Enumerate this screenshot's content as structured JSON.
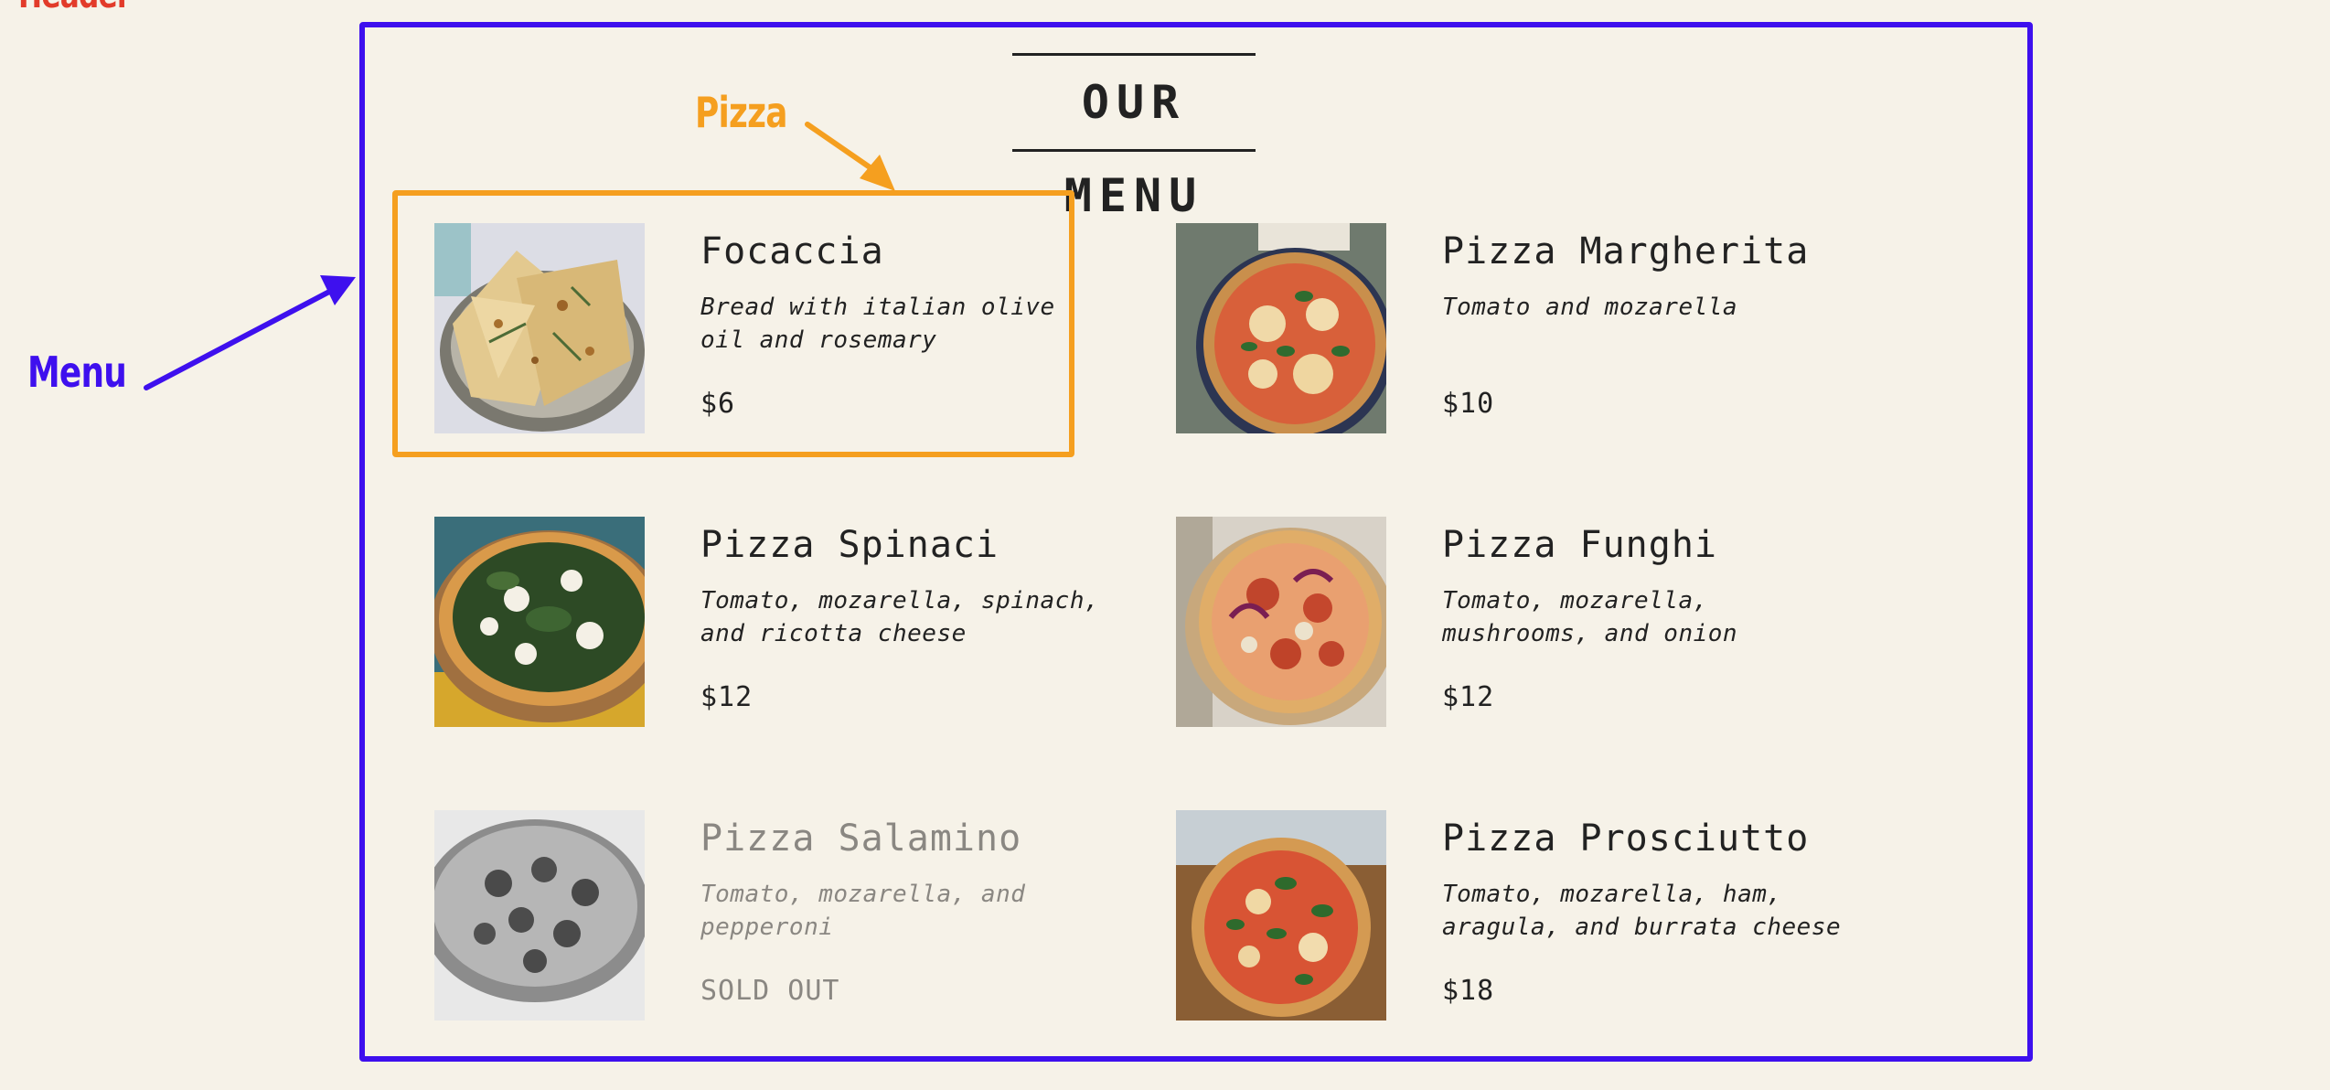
{
  "annotations": {
    "header": "Header",
    "menu": "Menu",
    "pizza": "Pizza"
  },
  "menu": {
    "title": "OUR MENU",
    "items": [
      {
        "name": "Focaccia",
        "description": "Bread with italian olive oil and rosemary",
        "price": "$6",
        "photo": "focaccia-photo"
      },
      {
        "name": "Pizza Margherita",
        "description": "Tomato and mozarella",
        "price": "$10",
        "photo": "pizza-margherita-photo"
      },
      {
        "name": "Pizza Spinaci",
        "description": "Tomato, mozarella, spinach, and ricotta cheese",
        "price": "$12",
        "photo": "pizza-spinaci-photo"
      },
      {
        "name": "Pizza Funghi",
        "description": "Tomato, mozarella, mushrooms, and onion",
        "price": "$12",
        "photo": "pizza-funghi-photo"
      },
      {
        "name": "Pizza Salamino",
        "description": "Tomato, mozarella, and pepperoni",
        "price": "SOLD OUT",
        "photo": "pizza-salamino-photo",
        "sold_out": true
      },
      {
        "name": "Pizza Prosciutto",
        "description": "Tomato, mozarella, ham, aragula, and burrata cheese",
        "price": "$18",
        "photo": "pizza-prosciutto-photo"
      }
    ]
  },
  "colors": {
    "background": "#f6f2e8",
    "menu_annotation": "#3e10ee",
    "pizza_annotation": "#f59f1f",
    "header_annotation": "#e23b2a",
    "text": "#222222",
    "sold_out_text": "#8a8782"
  }
}
